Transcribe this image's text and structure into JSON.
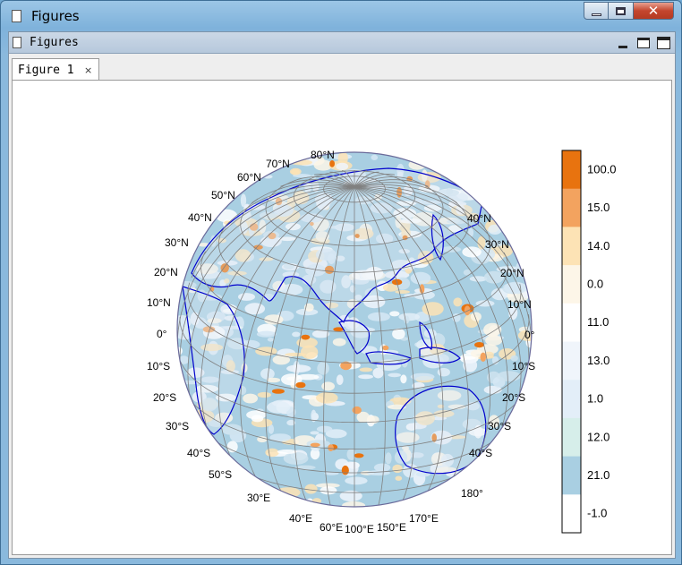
{
  "window": {
    "title": "Figures"
  },
  "panel": {
    "title": "Figures"
  },
  "tabs": [
    {
      "label": "Figure 1",
      "close_glyph": "×"
    }
  ],
  "map": {
    "projection": "orthographic",
    "lat_labels_left": [
      "80°N",
      "70°N",
      "60°N",
      "50°N",
      "40°N",
      "30°N",
      "20°N",
      "10°N",
      "0°",
      "10°S",
      "20°S",
      "30°S",
      "40°S",
      "50°S"
    ],
    "lat_labels_right": [
      "40°N",
      "30°N",
      "20°N",
      "10°N",
      "0°",
      "10°S",
      "20°S",
      "30°S",
      "40°S"
    ],
    "lon_labels": [
      "30°E",
      "40°E",
      "60°E",
      "100°E",
      "150°E",
      "170°E",
      "180°"
    ],
    "coastline_color": "#0000cc",
    "graticule_color": "#808080"
  },
  "colorbar": {
    "labels": [
      "100.0",
      "15.0",
      "14.0",
      "0.0",
      "11.0",
      "13.0",
      "1.0",
      "12.0",
      "21.0",
      "-1.0"
    ],
    "colors": [
      "#e8730f",
      "#f3a35f",
      "#fde3b5",
      "#fdf6e8",
      "#ffffff",
      "#f0f5fb",
      "#e3eef8",
      "#d6eeea",
      "#a9cfe2",
      "#ffffff"
    ]
  }
}
